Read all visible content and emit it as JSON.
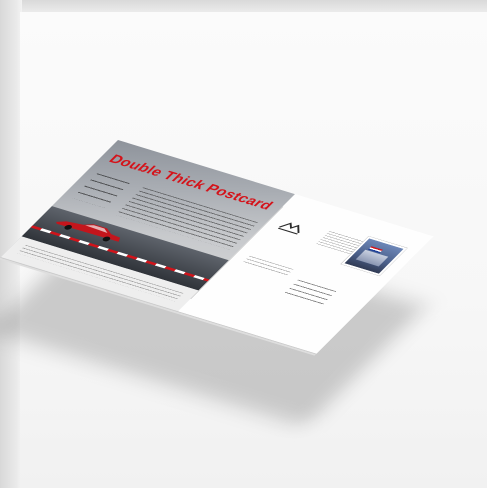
{
  "photo": {
    "subject": "double-thick-postcard-mockup",
    "colors": {
      "brand_red": "#d4131a",
      "card_gray": "#a9adb3",
      "paper_white": "#fdfdfd"
    }
  },
  "postcard": {
    "front": {
      "kicker": "",
      "title": "Double Thick Postcard",
      "title_note": "",
      "sections": [
        {
          "label": "",
          "text": ""
        }
      ],
      "footer": {
        "left": "",
        "middle": "",
        "right": ""
      }
    },
    "back": {
      "sender": "",
      "address_block": "",
      "recipient": ""
    }
  }
}
